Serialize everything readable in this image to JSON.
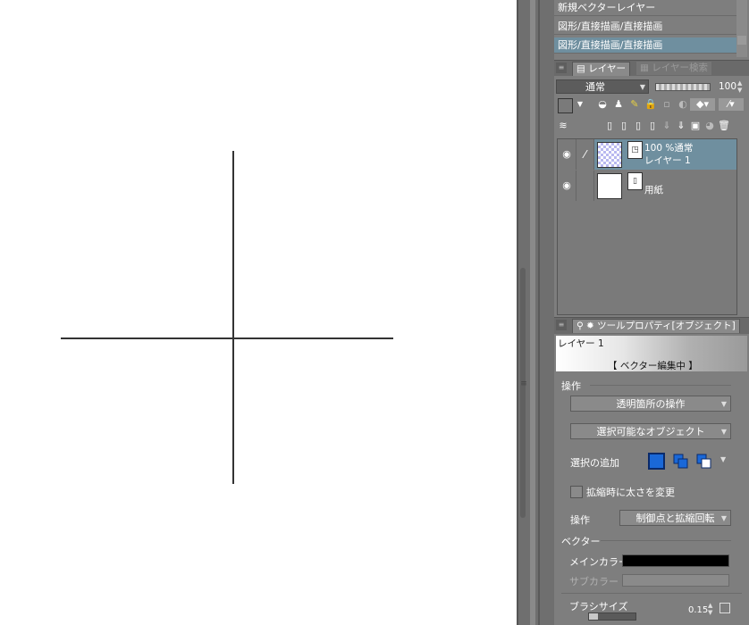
{
  "history": {
    "items": [
      {
        "label": "新規ベクターレイヤー"
      },
      {
        "label": "図形/直接描画/直接描画"
      },
      {
        "label": "図形/直接描画/直接描画",
        "selected": true
      }
    ]
  },
  "layer_panel": {
    "tabs": [
      {
        "label": "レイヤー",
        "active": true
      },
      {
        "label": "レイヤー検索",
        "active": false
      }
    ],
    "blend_mode": "通常",
    "opacity": "100",
    "layers": [
      {
        "line1": "100 %通常",
        "line2": "レイヤー 1",
        "selected": true,
        "visible": true
      },
      {
        "line1": "",
        "line2": "用紙",
        "selected": false,
        "visible": true
      }
    ]
  },
  "tool_property": {
    "tab_label": "ツールプロパティ[オブジェクト]",
    "banner_layer": "レイヤー 1",
    "banner_status": "【 ベクター編集中 】",
    "section_operation": "操作",
    "transparent_op": "透明箇所の操作",
    "selectable_object": "選択可能なオブジェクト",
    "selection_add_label": "選択の追加",
    "scale_width_label": "拡縮時に太さを変更",
    "scale_width_checked": false,
    "operation_label": "操作",
    "operation_value": "制御点と拡縮回転",
    "section_vector": "ベクター",
    "main_color_label": "メインカラー",
    "main_color": "#000000",
    "sub_color_label": "サブカラー",
    "brush_size_label": "ブラシサイズ",
    "brush_size_value": "0.15"
  },
  "canvas": {
    "line_color": "#333333",
    "background": "#ffffff"
  }
}
